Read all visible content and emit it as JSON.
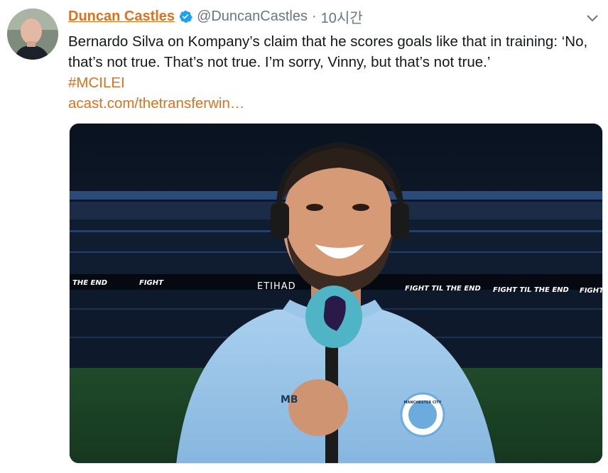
{
  "author": {
    "display_name": "Duncan Castles",
    "handle": "@DuncanCastles",
    "separator": "·",
    "timestamp": "10시간",
    "verified": true
  },
  "tweet": {
    "text": "Bernardo Silva on Kompany’s claim that he scores goals like that in training: ‘No, that’s not true. That’s not true. I’m sorry, Vinny, but that’s not true.’",
    "hashtag": "#MCILEI",
    "link": "acast.com/thetransferwin…"
  },
  "media": {
    "board_left": "THE END",
    "board_left_2": "FIGHT",
    "board_center": "ETIHAD",
    "board_right": "FIGHT TIL THE END",
    "board_right_2": "FIGHT TIL THE END",
    "board_right_3": "FIGHT",
    "initials": "MB",
    "badge_text": "MANCHESTER CITY"
  },
  "colors": {
    "link": "#e0701b",
    "verified": "#1da1f2",
    "muted": "#657786"
  },
  "icons": [
    "avatar",
    "verified-badge-icon",
    "chevron-down-icon"
  ]
}
